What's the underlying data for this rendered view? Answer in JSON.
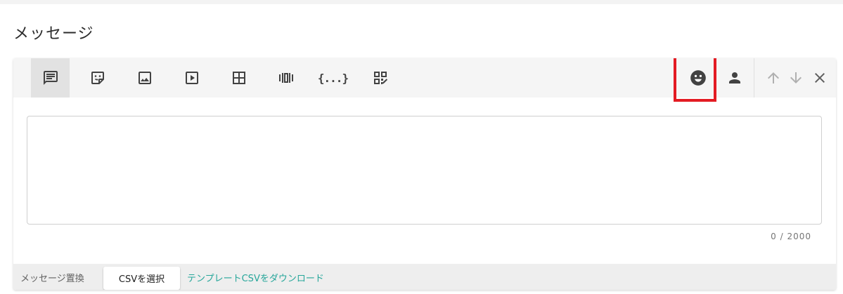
{
  "page": {
    "title": "メッセージ"
  },
  "toolbar": {
    "message_types": [
      {
        "icon": "text-message-icon",
        "active": true
      },
      {
        "icon": "sticker-icon",
        "active": false
      },
      {
        "icon": "image-icon",
        "active": false
      },
      {
        "icon": "video-icon",
        "active": false
      },
      {
        "icon": "imagemap-icon",
        "active": false
      },
      {
        "icon": "carousel-icon",
        "active": false
      },
      {
        "icon": "flex-json-icon",
        "active": false
      },
      {
        "icon": "qr-code-icon",
        "active": false
      }
    ],
    "braces_glyph": "{...}",
    "right_actions": [
      {
        "icon": "emoji-icon",
        "highlighted": true
      },
      {
        "icon": "person-icon"
      },
      {
        "icon": "arrow-up-icon"
      },
      {
        "icon": "arrow-down-icon"
      },
      {
        "icon": "close-icon"
      }
    ]
  },
  "editor": {
    "value": "",
    "counter": "0 / 2000"
  },
  "footer": {
    "label": "メッセージ置換",
    "select_csv_button": "CSVを選択",
    "download_template_link": "テンプレートCSVをダウンロード"
  },
  "colors": {
    "highlight": "#e31b23",
    "link": "#26a69a",
    "icon": "#424242",
    "icon_disabled": "#b0b0b0"
  }
}
